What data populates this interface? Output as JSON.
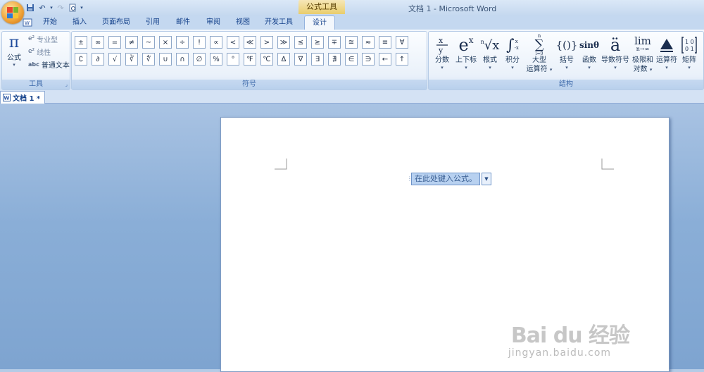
{
  "titlebar": {
    "context_title": "公式工具",
    "window_title": "文档 1 - Microsoft Word"
  },
  "tabs": [
    "开始",
    "插入",
    "页面布局",
    "引用",
    "邮件",
    "审阅",
    "视图",
    "开发工具",
    "设计"
  ],
  "active_tab": "设计",
  "tools_group": {
    "formula_label": "公式",
    "professional_label": "专业型",
    "linear_label": "线性",
    "normal_text_label": "普通文本",
    "normal_text_icon": "abc",
    "group_label": "工具"
  },
  "symbols_group": {
    "row1": [
      "±",
      "∞",
      "=",
      "≠",
      "~",
      "×",
      "÷",
      "!",
      "∝",
      "<",
      "≪",
      ">",
      "≫",
      "≤",
      "≥",
      "∓",
      "≅",
      "≈",
      "≡",
      "∀"
    ],
    "row2": [
      "∁",
      "∂",
      "√",
      "∛",
      "∜",
      "∪",
      "∩",
      "∅",
      "%",
      "°",
      "℉",
      "℃",
      "∆",
      "∇",
      "∃",
      "∄",
      "∈",
      "∋",
      "←",
      "↑"
    ],
    "group_label": "符号"
  },
  "structure_group": {
    "items": [
      {
        "label": "分数",
        "label2": ""
      },
      {
        "label": "上下标",
        "label2": ""
      },
      {
        "label": "根式",
        "label2": ""
      },
      {
        "label": "积分",
        "label2": ""
      },
      {
        "label": "大型",
        "label2": "运算符"
      },
      {
        "label": "括号",
        "label2": ""
      },
      {
        "label": "函数",
        "label2": ""
      },
      {
        "label": "导数符号",
        "label2": ""
      },
      {
        "label": "极限和",
        "label2": "对数"
      },
      {
        "label": "运算符",
        "label2": ""
      },
      {
        "label": "矩阵",
        "label2": ""
      }
    ],
    "group_label": "结构"
  },
  "document": {
    "tab_title": "文档 1 *",
    "equation_placeholder": "在此处键入公式。"
  },
  "watermark": {
    "brand": "Bai du 经验",
    "url": "jingyan.baidu.com"
  },
  "colors": {
    "ribbon_accent": "#1d4a9b",
    "context_tab": "#e9cd6c",
    "workspace": "#8aaed7"
  }
}
